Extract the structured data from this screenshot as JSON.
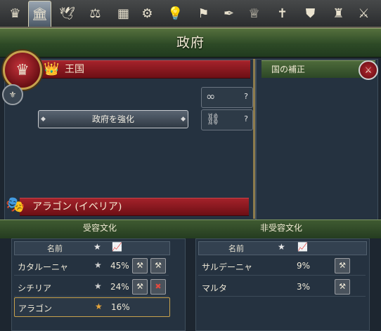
{
  "tabs": [
    {
      "icon": "crown-tab-icon",
      "glyph": "♛"
    },
    {
      "icon": "government-building-icon",
      "glyph": "🏛"
    },
    {
      "icon": "dove-icon",
      "glyph": "🕊"
    },
    {
      "icon": "trade-goods-icon",
      "glyph": "⚖"
    },
    {
      "icon": "crate-icon",
      "glyph": "▦"
    },
    {
      "icon": "gears-icon",
      "glyph": "⚙"
    },
    {
      "icon": "lightbulb-icon",
      "glyph": "💡"
    },
    {
      "icon": "flag-icon",
      "glyph": "⚑"
    },
    {
      "icon": "quill-icon",
      "glyph": "✒"
    },
    {
      "icon": "royal-crown-icon",
      "glyph": "♕"
    },
    {
      "icon": "cross-icon",
      "glyph": "✝"
    },
    {
      "icon": "shield-icon",
      "glyph": "⛊"
    },
    {
      "icon": "estates-icon",
      "glyph": "♜"
    },
    {
      "icon": "crossed-swords-icon",
      "glyph": "⚔"
    }
  ],
  "header": {
    "title": "政府"
  },
  "government": {
    "type_label": "王国",
    "strengthen_label": "政府を強化",
    "reform_slots": [
      {
        "icon": "link-icon",
        "glyph": "∞",
        "mark": "?"
      },
      {
        "icon": "chain-icon",
        "glyph": "⛓",
        "mark": "?"
      }
    ]
  },
  "modifiers": {
    "title": "国の補正"
  },
  "culture": {
    "primary_label": "アラゴン (イベリア)",
    "accepted_title": "受容文化",
    "non_accepted_title": "非受容文化",
    "columns": {
      "name": "名前",
      "star": "★",
      "chart": "📈"
    },
    "accepted": [
      {
        "name": "カタルーニャ",
        "percent": "45%"
      },
      {
        "name": "シチリア",
        "percent": "24%"
      },
      {
        "name": "アラゴン",
        "percent": "16%"
      }
    ],
    "non_accepted": [
      {
        "name": "サルデーニャ",
        "percent": "9%"
      },
      {
        "name": "マルタ",
        "percent": "3%"
      }
    ]
  }
}
